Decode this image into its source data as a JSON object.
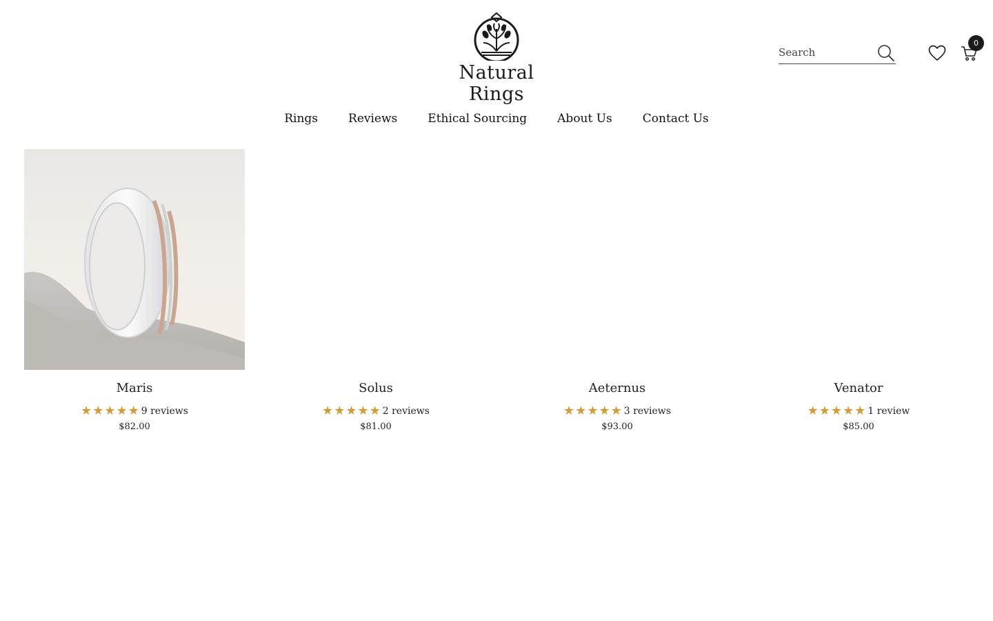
{
  "brand": {
    "name": "Natural Rings",
    "colors": {
      "text": "#1a1a1a",
      "star": "#d59b36",
      "background": "#ffffff"
    }
  },
  "header": {
    "search": {
      "placeholder": "Search",
      "value": "",
      "icon": "search-icon"
    },
    "wishlist": {
      "icon": "heart-icon"
    },
    "cart": {
      "icon": "cart-icon",
      "count": "0"
    }
  },
  "nav": {
    "items": [
      {
        "label": "Rings"
      },
      {
        "label": "Reviews"
      },
      {
        "label": "Ethical Sourcing"
      },
      {
        "label": "About Us"
      },
      {
        "label": "Contact Us"
      }
    ]
  },
  "products": [
    {
      "title": "Maris",
      "rating": 5,
      "reviews": "9 reviews",
      "price": "$82.00",
      "image": "ring-photo"
    },
    {
      "title": "Solus",
      "rating": 5,
      "reviews": "2 reviews",
      "price": "$81.00",
      "image": ""
    },
    {
      "title": "Aeternus",
      "rating": 5,
      "reviews": "3 reviews",
      "price": "$93.00",
      "image": ""
    },
    {
      "title": "Venator",
      "rating": 5,
      "reviews": "1 review",
      "price": "$85.00",
      "image": ""
    }
  ]
}
